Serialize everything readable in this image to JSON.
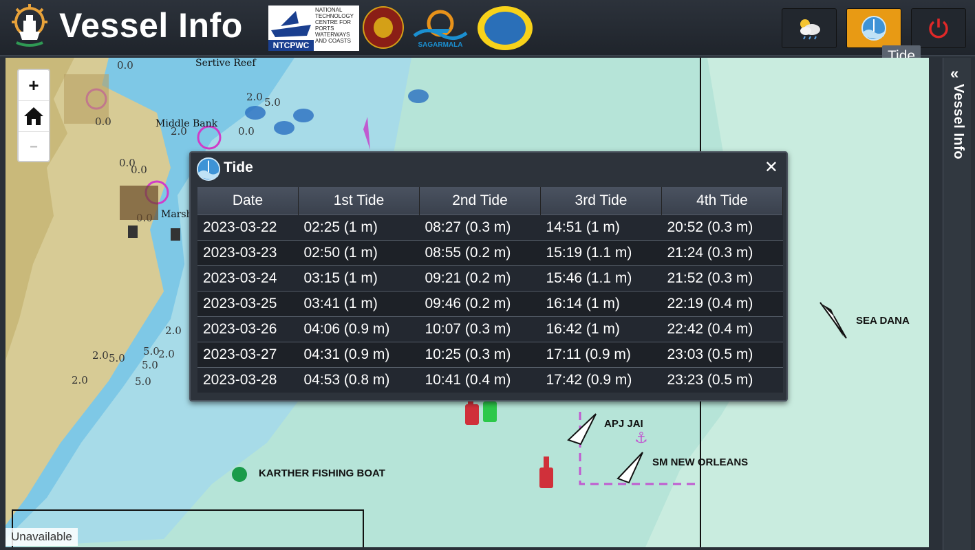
{
  "app": {
    "title": "Vessel Info"
  },
  "logos": {
    "ntcpwc_tag": "NTCPWC",
    "ntcpwc_text": "NATIONAL TECHNOLOGY CENTRE FOR PORTS WATERWAYS AND COASTS",
    "sagarmala": "SAGARMALA"
  },
  "header": {
    "weather_icon": "weather-cloud-sun-icon",
    "tide_icon": "tide-icon",
    "power_icon": "power-icon",
    "tooltip": "Tide"
  },
  "sidebar": {
    "collapse": "«",
    "label": "Vessel Info"
  },
  "map": {
    "zoom_in": "+",
    "zoom_out": "−",
    "home_icon": "home-icon",
    "status": "Unavailable",
    "chart_labels": {
      "reef": "Sertive Reef",
      "bank": "Middle Bank",
      "marsh": "Marsh"
    },
    "vessels": [
      "SEA DANA",
      "APJ JAI",
      "SM NEW ORLEANS",
      "KARTHER FISHING BOAT"
    ]
  },
  "dialog": {
    "title": "Tide",
    "close": "✕",
    "headers": [
      "Date",
      "1st Tide",
      "2nd Tide",
      "3rd Tide",
      "4th Tide"
    ],
    "rows": [
      [
        "2023-03-22",
        "02:25 (1 m)",
        "08:27 (0.3 m)",
        "14:51 (1 m)",
        "20:52 (0.3 m)"
      ],
      [
        "2023-03-23",
        "02:50 (1 m)",
        "08:55 (0.2 m)",
        "15:19 (1.1 m)",
        "21:24 (0.3 m)"
      ],
      [
        "2023-03-24",
        "03:15 (1 m)",
        "09:21 (0.2 m)",
        "15:46 (1.1 m)",
        "21:52 (0.3 m)"
      ],
      [
        "2023-03-25",
        "03:41 (1 m)",
        "09:46 (0.2 m)",
        "16:14 (1 m)",
        "22:19 (0.4 m)"
      ],
      [
        "2023-03-26",
        "04:06 (0.9 m)",
        "10:07 (0.3 m)",
        "16:42 (1 m)",
        "22:42 (0.4 m)"
      ],
      [
        "2023-03-27",
        "04:31 (0.9 m)",
        "10:25 (0.3 m)",
        "17:11 (0.9 m)",
        "23:03 (0.5 m)"
      ],
      [
        "2023-03-28",
        "04:53 (0.8 m)",
        "10:41 (0.4 m)",
        "17:42 (0.9 m)",
        "23:23 (0.5 m)"
      ]
    ]
  }
}
